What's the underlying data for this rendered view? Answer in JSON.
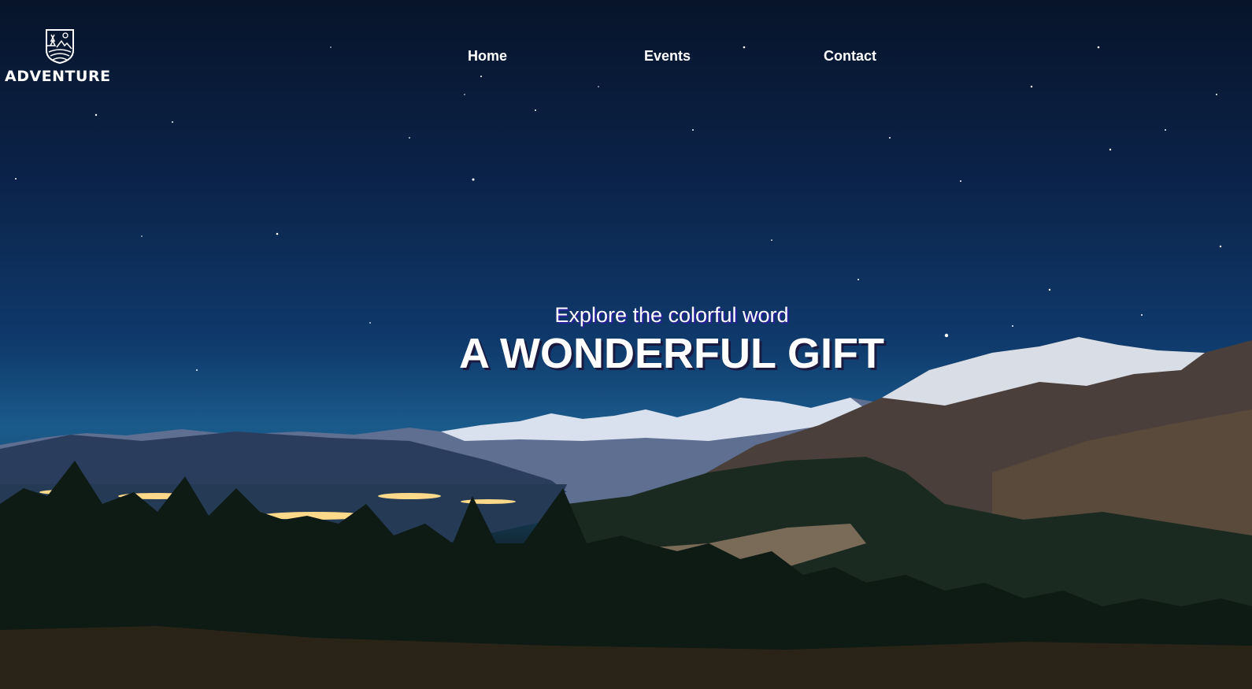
{
  "brand": {
    "name": "ADVENTURE",
    "icon": "mountain-crest-icon"
  },
  "nav": {
    "items": [
      {
        "label": "Home"
      },
      {
        "label": "Events"
      },
      {
        "label": "Contact"
      }
    ]
  },
  "hero": {
    "tagline": "Explore the colorful word",
    "headline": "A WONDERFUL GIFT"
  },
  "colors": {
    "sky_top": "#07142a",
    "sky_mid": "#0f3a6c",
    "horizon": "#1a5b8c",
    "text": "#ffffff",
    "tagline_shadow": "#2a1f9e"
  }
}
